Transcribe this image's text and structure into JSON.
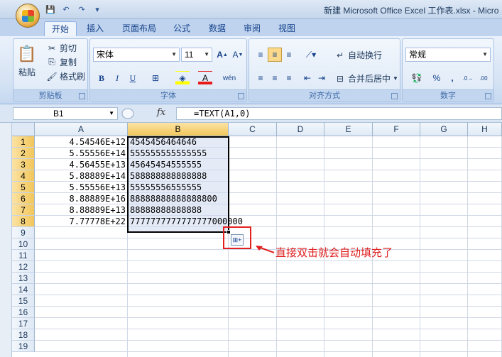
{
  "window": {
    "title": "新建 Microsoft Office Excel 工作表.xlsx - Micro"
  },
  "tabs": [
    "开始",
    "插入",
    "页面布局",
    "公式",
    "数据",
    "审阅",
    "视图"
  ],
  "ribbon": {
    "clipboard": {
      "label": "剪贴板",
      "paste": "粘贴",
      "cut": "剪切",
      "copy": "复制",
      "format_painter": "格式刷"
    },
    "font": {
      "label": "字体",
      "font_name": "宋体",
      "font_size": "11",
      "bold": "B",
      "italic": "I",
      "underline": "U"
    },
    "alignment": {
      "label": "对齐方式",
      "wrap_text": "自动换行",
      "merge_center": "合并后居中"
    },
    "number": {
      "label": "数字",
      "format": "常规",
      "percent": "%",
      "comma": ","
    }
  },
  "formula_bar": {
    "cell_ref": "B1",
    "fx": "fx",
    "formula": "=TEXT(A1,0)"
  },
  "sheet": {
    "columns": [
      "A",
      "B",
      "C",
      "D",
      "E",
      "F",
      "G",
      "H"
    ],
    "rows": [
      "1",
      "2",
      "3",
      "4",
      "5",
      "6",
      "7",
      "8",
      "9",
      "10",
      "11",
      "12",
      "13",
      "14",
      "15",
      "16",
      "17",
      "18",
      "19"
    ],
    "col_a": [
      "4.54546E+12",
      "5.55556E+14",
      "4.56455E+13",
      "5.88889E+14",
      "5.55556E+13",
      "8.88889E+16",
      "8.88889E+13",
      "7.77778E+22"
    ],
    "col_b": [
      "4545456464646",
      "555555555555555",
      "45645454555555",
      "588888888888888",
      "55555556555555",
      "88888888888888800",
      "88888888888888",
      "7777777777777777000000"
    ]
  },
  "annotation": {
    "text": "直接双击就会自动填充了",
    "color": "#e02020"
  },
  "colors": {
    "accent": "#15428b",
    "selection_header": "#f2c65b",
    "annotation": "#e02020"
  }
}
